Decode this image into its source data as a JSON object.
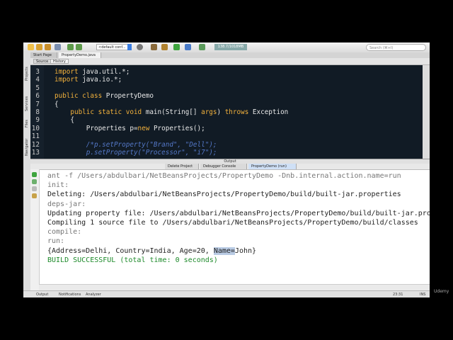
{
  "toolbar": {
    "config_label": "<default conf...",
    "memory_label": "138.7/1018MB",
    "search_placeholder": "Search (⌘+I)"
  },
  "sidebar": {
    "items": [
      "Projects",
      "Services",
      "Files",
      "Navigator"
    ]
  },
  "editor_tabs": [
    {
      "label": "Start Page"
    },
    {
      "label": "PropertyDemo.java"
    }
  ],
  "view_buttons": {
    "source": "Source",
    "history": "History"
  },
  "code_lines": [
    {
      "num": "3",
      "segments": [
        {
          "t": "import",
          "c": "kw"
        },
        {
          "t": " java.util.*;",
          "c": ""
        }
      ]
    },
    {
      "num": "4",
      "segments": [
        {
          "t": "import",
          "c": "kw"
        },
        {
          "t": " java.io.*;",
          "c": ""
        }
      ]
    },
    {
      "num": "5",
      "segments": []
    },
    {
      "num": "6",
      "segments": [
        {
          "t": "public class",
          "c": "kw"
        },
        {
          "t": " PropertyDemo",
          "c": ""
        }
      ]
    },
    {
      "num": "7",
      "segments": [
        {
          "t": "{",
          "c": ""
        }
      ]
    },
    {
      "num": "8",
      "segments": [
        {
          "t": "    public static void",
          "c": "kw"
        },
        {
          "t": " main(String[] ",
          "c": ""
        },
        {
          "t": "args",
          "c": "kw"
        },
        {
          "t": ") ",
          "c": ""
        },
        {
          "t": "throws",
          "c": "kw"
        },
        {
          "t": " Exception",
          "c": ""
        }
      ]
    },
    {
      "num": "9",
      "segments": [
        {
          "t": "    {",
          "c": ""
        }
      ]
    },
    {
      "num": "10",
      "segments": [
        {
          "t": "        Properties p=",
          "c": ""
        },
        {
          "t": "new",
          "c": "kw"
        },
        {
          "t": " Properties();",
          "c": ""
        }
      ]
    },
    {
      "num": "11",
      "segments": []
    },
    {
      "num": "12",
      "segments": [
        {
          "t": "        /*p.setProperty(\"Brand\", \"Dell\");",
          "c": "cm"
        }
      ]
    },
    {
      "num": "13",
      "segments": [
        {
          "t": "        p.setProperty(\"Processor\", \"i7\");",
          "c": "cm"
        }
      ]
    }
  ],
  "output": {
    "title": "Output",
    "tabs": [
      {
        "label": "Delete Project"
      },
      {
        "label": "Debugger Console"
      },
      {
        "label": "PropertyDemo (run)"
      }
    ],
    "lines": [
      {
        "text": "ant -f /Users/abdulbari/NetBeansProjects/PropertyDemo -Dnb.internal.action.name=run",
        "style": "gray"
      },
      {
        "text": "init:",
        "style": "gray"
      },
      {
        "text": "Deleting: /Users/abdulbari/NetBeansProjects/PropertyDemo/build/built-jar.properties",
        "style": ""
      },
      {
        "text": "deps-jar:",
        "style": "gray"
      },
      {
        "text": "Updating property file: /Users/abdulbari/NetBeansProjects/PropertyDemo/build/built-jar.properties",
        "style": ""
      },
      {
        "text": "Compiling 1 source file to /Users/abdulbari/NetBeansProjects/PropertyDemo/build/classes",
        "style": ""
      },
      {
        "text": "compile:",
        "style": "gray"
      },
      {
        "text": "run:",
        "style": "gray"
      }
    ],
    "result_prefix": "{Address=Delhi, Country=India, Age=20, ",
    "result_highlight": "Name=",
    "result_suffix": "John}",
    "build_line": "BUILD SUCCESSFUL (total time: 0 seconds)"
  },
  "statusbar": {
    "output_label": "Output",
    "notifications_label": "Notifications",
    "analyzer_label": "Analyzer",
    "position": "23:31",
    "mode": "INS"
  },
  "watermark": "Udemy",
  "colors": {
    "editor_bg": "#111b25",
    "keyword": "#f2b13c",
    "comment": "#5478c8",
    "success": "#1d8a2a",
    "selection": "#b9cbe4"
  }
}
